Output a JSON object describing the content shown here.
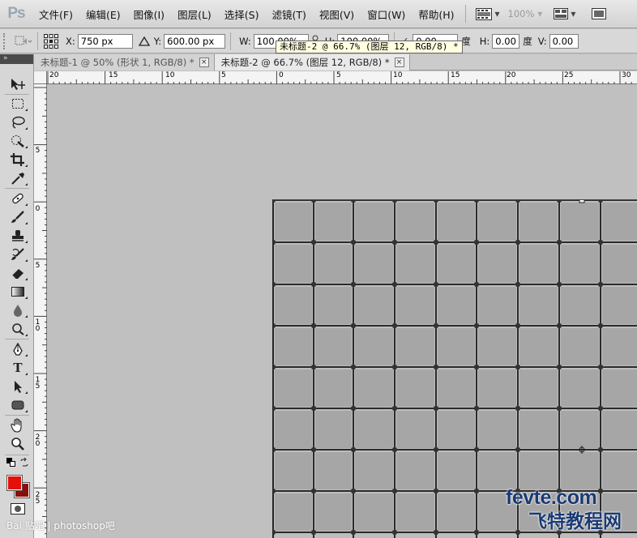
{
  "app": {
    "logo": "Ps"
  },
  "menu": [
    "文件(F)",
    "编辑(E)",
    "图像(I)",
    "图层(L)",
    "选择(S)",
    "滤镜(T)",
    "视图(V)",
    "窗口(W)",
    "帮助(H)"
  ],
  "menubar_zoom": "100%",
  "options": {
    "x_label": "X:",
    "x_value": "750 px",
    "y_label": "Y:",
    "y_value": "600.00 px",
    "w_label": "W:",
    "w_value": "100.00%",
    "h_label": "H:",
    "h_value": "100.00%",
    "angle_value": "0.00",
    "angle_unit": "度",
    "hskew_label": "H:",
    "hskew_value": "0.00",
    "hskew_unit": "度",
    "vskew_label": "V:",
    "vskew_value": "0.00"
  },
  "tabs": [
    {
      "label": "未标题-1 @ 50% (形状 1, RGB/8) *",
      "close": "×"
    },
    {
      "label": "未标题-2 @ 66.7% (图层 12, RGB/8) *",
      "close": "×"
    }
  ],
  "tooltip": "未标题-2 @ 66.7% (图层 12, RGB/8) *",
  "toolbox_header": "»",
  "hruler_labels": [
    "20",
    "15",
    "10",
    "5",
    "0",
    "5",
    "10",
    "15",
    "20",
    "25",
    "30"
  ],
  "vruler_labels": [
    "5",
    "0",
    "5",
    "1 0",
    "1 5",
    "2 0",
    "2 5"
  ],
  "colors": {
    "foreground": "#e4100a",
    "background": "#8c0e0a"
  },
  "watermarks": {
    "baidu": "Bai 贴吧 | photoshop吧",
    "fevte": "fevte.com",
    "fevte_cn": "飞特教程网"
  }
}
